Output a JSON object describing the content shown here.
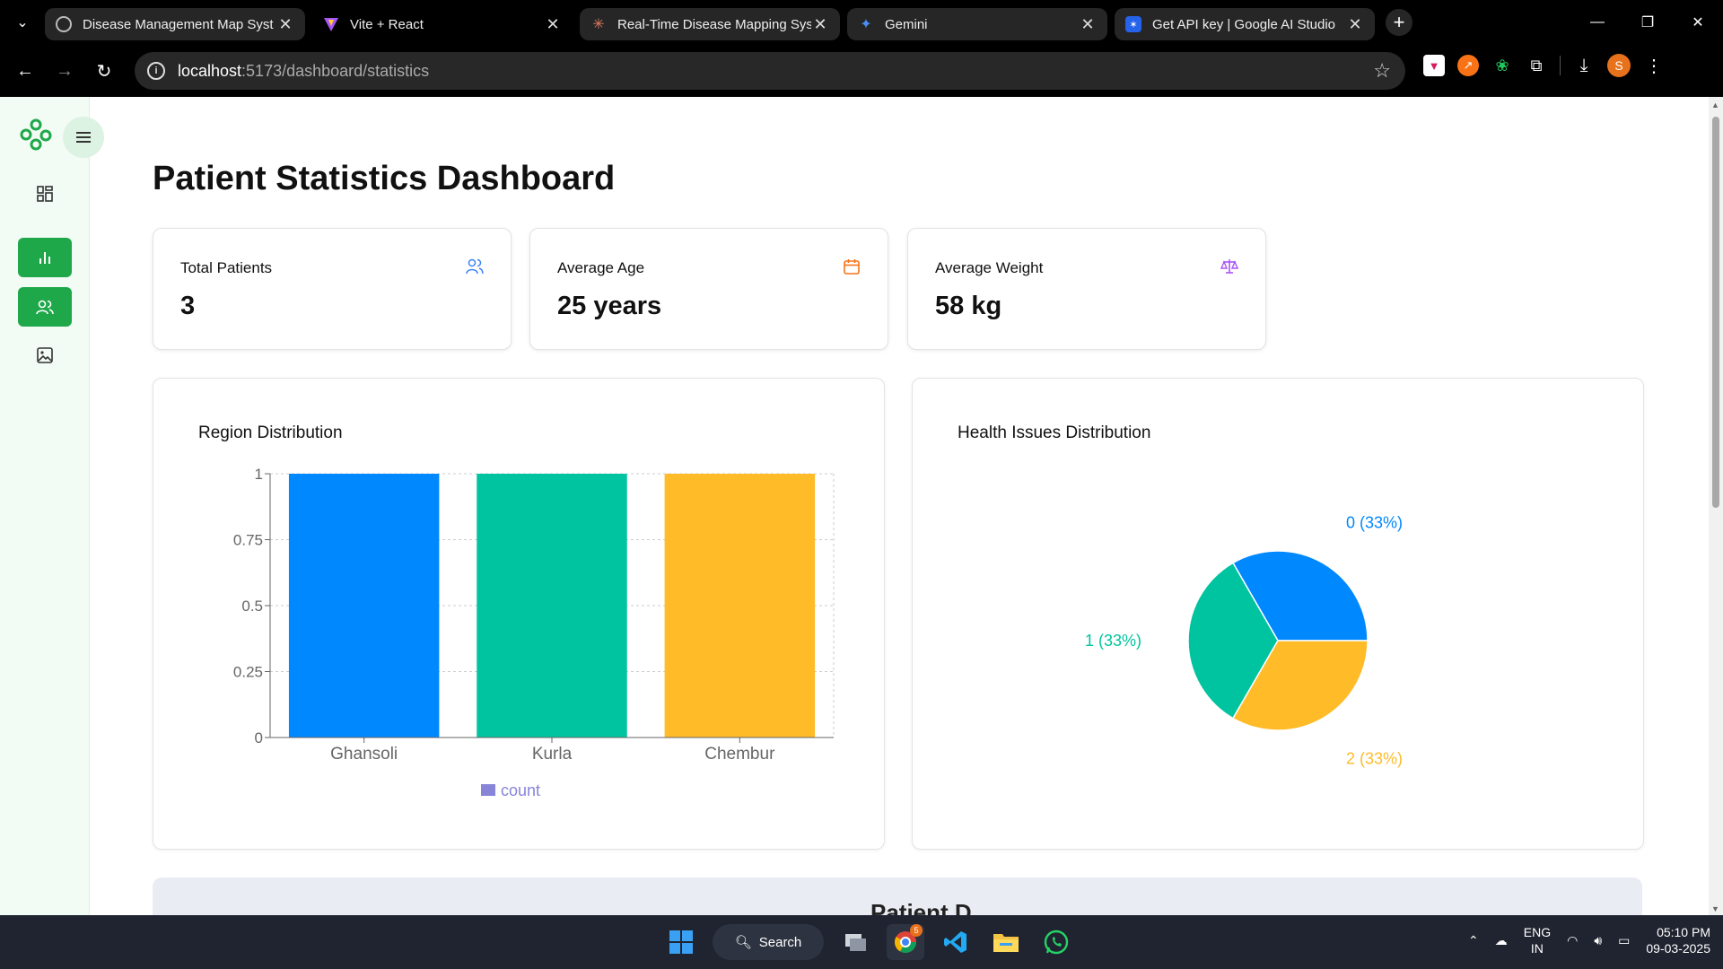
{
  "browser": {
    "tabs": [
      {
        "title": "Disease Management Map Syst",
        "icon_color": "#888888"
      },
      {
        "title": "Vite + React",
        "icon_color": "#a855f7"
      },
      {
        "title": "Real-Time Disease Mapping Sys",
        "icon_color": "#e07a5f"
      },
      {
        "title": "Gemini",
        "icon_color": "#4a8df8"
      },
      {
        "title": "Get API key | Google AI Studio",
        "icon_color": "#3b82f6"
      }
    ],
    "url_host": "localhost",
    "url_path": ":5173/dashboard/statistics"
  },
  "page": {
    "title": "Patient Statistics Dashboard",
    "stats": [
      {
        "label": "Total Patients",
        "value": "3",
        "icon": "users-icon",
        "color": "#3b82f6"
      },
      {
        "label": "Average Age",
        "value": "25 years",
        "icon": "calendar-icon",
        "color": "#f97316"
      },
      {
        "label": "Average Weight",
        "value": "58 kg",
        "icon": "scale-icon",
        "color": "#a855f7"
      }
    ],
    "bottom_title": "Patient D"
  },
  "chart_data": [
    {
      "type": "bar",
      "title": "Region Distribution",
      "categories": [
        "Ghansoli",
        "Kurla",
        "Chembur"
      ],
      "series": [
        {
          "name": "count",
          "values": [
            1,
            1,
            1
          ]
        }
      ],
      "colors": [
        "#0088FE",
        "#00C49F",
        "#FFBB28"
      ],
      "legend_color": "#8884d8",
      "ylim": [
        0,
        1
      ],
      "yticks": [
        "0",
        "0.25",
        "0.5",
        "0.75",
        "1"
      ],
      "grid": true,
      "legend": "bottom"
    },
    {
      "type": "pie",
      "title": "Health Issues Distribution",
      "categories": [
        "0",
        "1",
        "2"
      ],
      "values": [
        1,
        1,
        1
      ],
      "labels": [
        "0 (33%)",
        "1 (33%)",
        "2 (33%)"
      ],
      "colors": [
        "#0088FE",
        "#00C49F",
        "#FFBB28"
      ]
    }
  ],
  "taskbar": {
    "search_label": "Search",
    "lang_top": "ENG",
    "lang_bottom": "IN",
    "time": "05:10 PM",
    "date": "09-03-2025",
    "chrome_badge": "5"
  }
}
